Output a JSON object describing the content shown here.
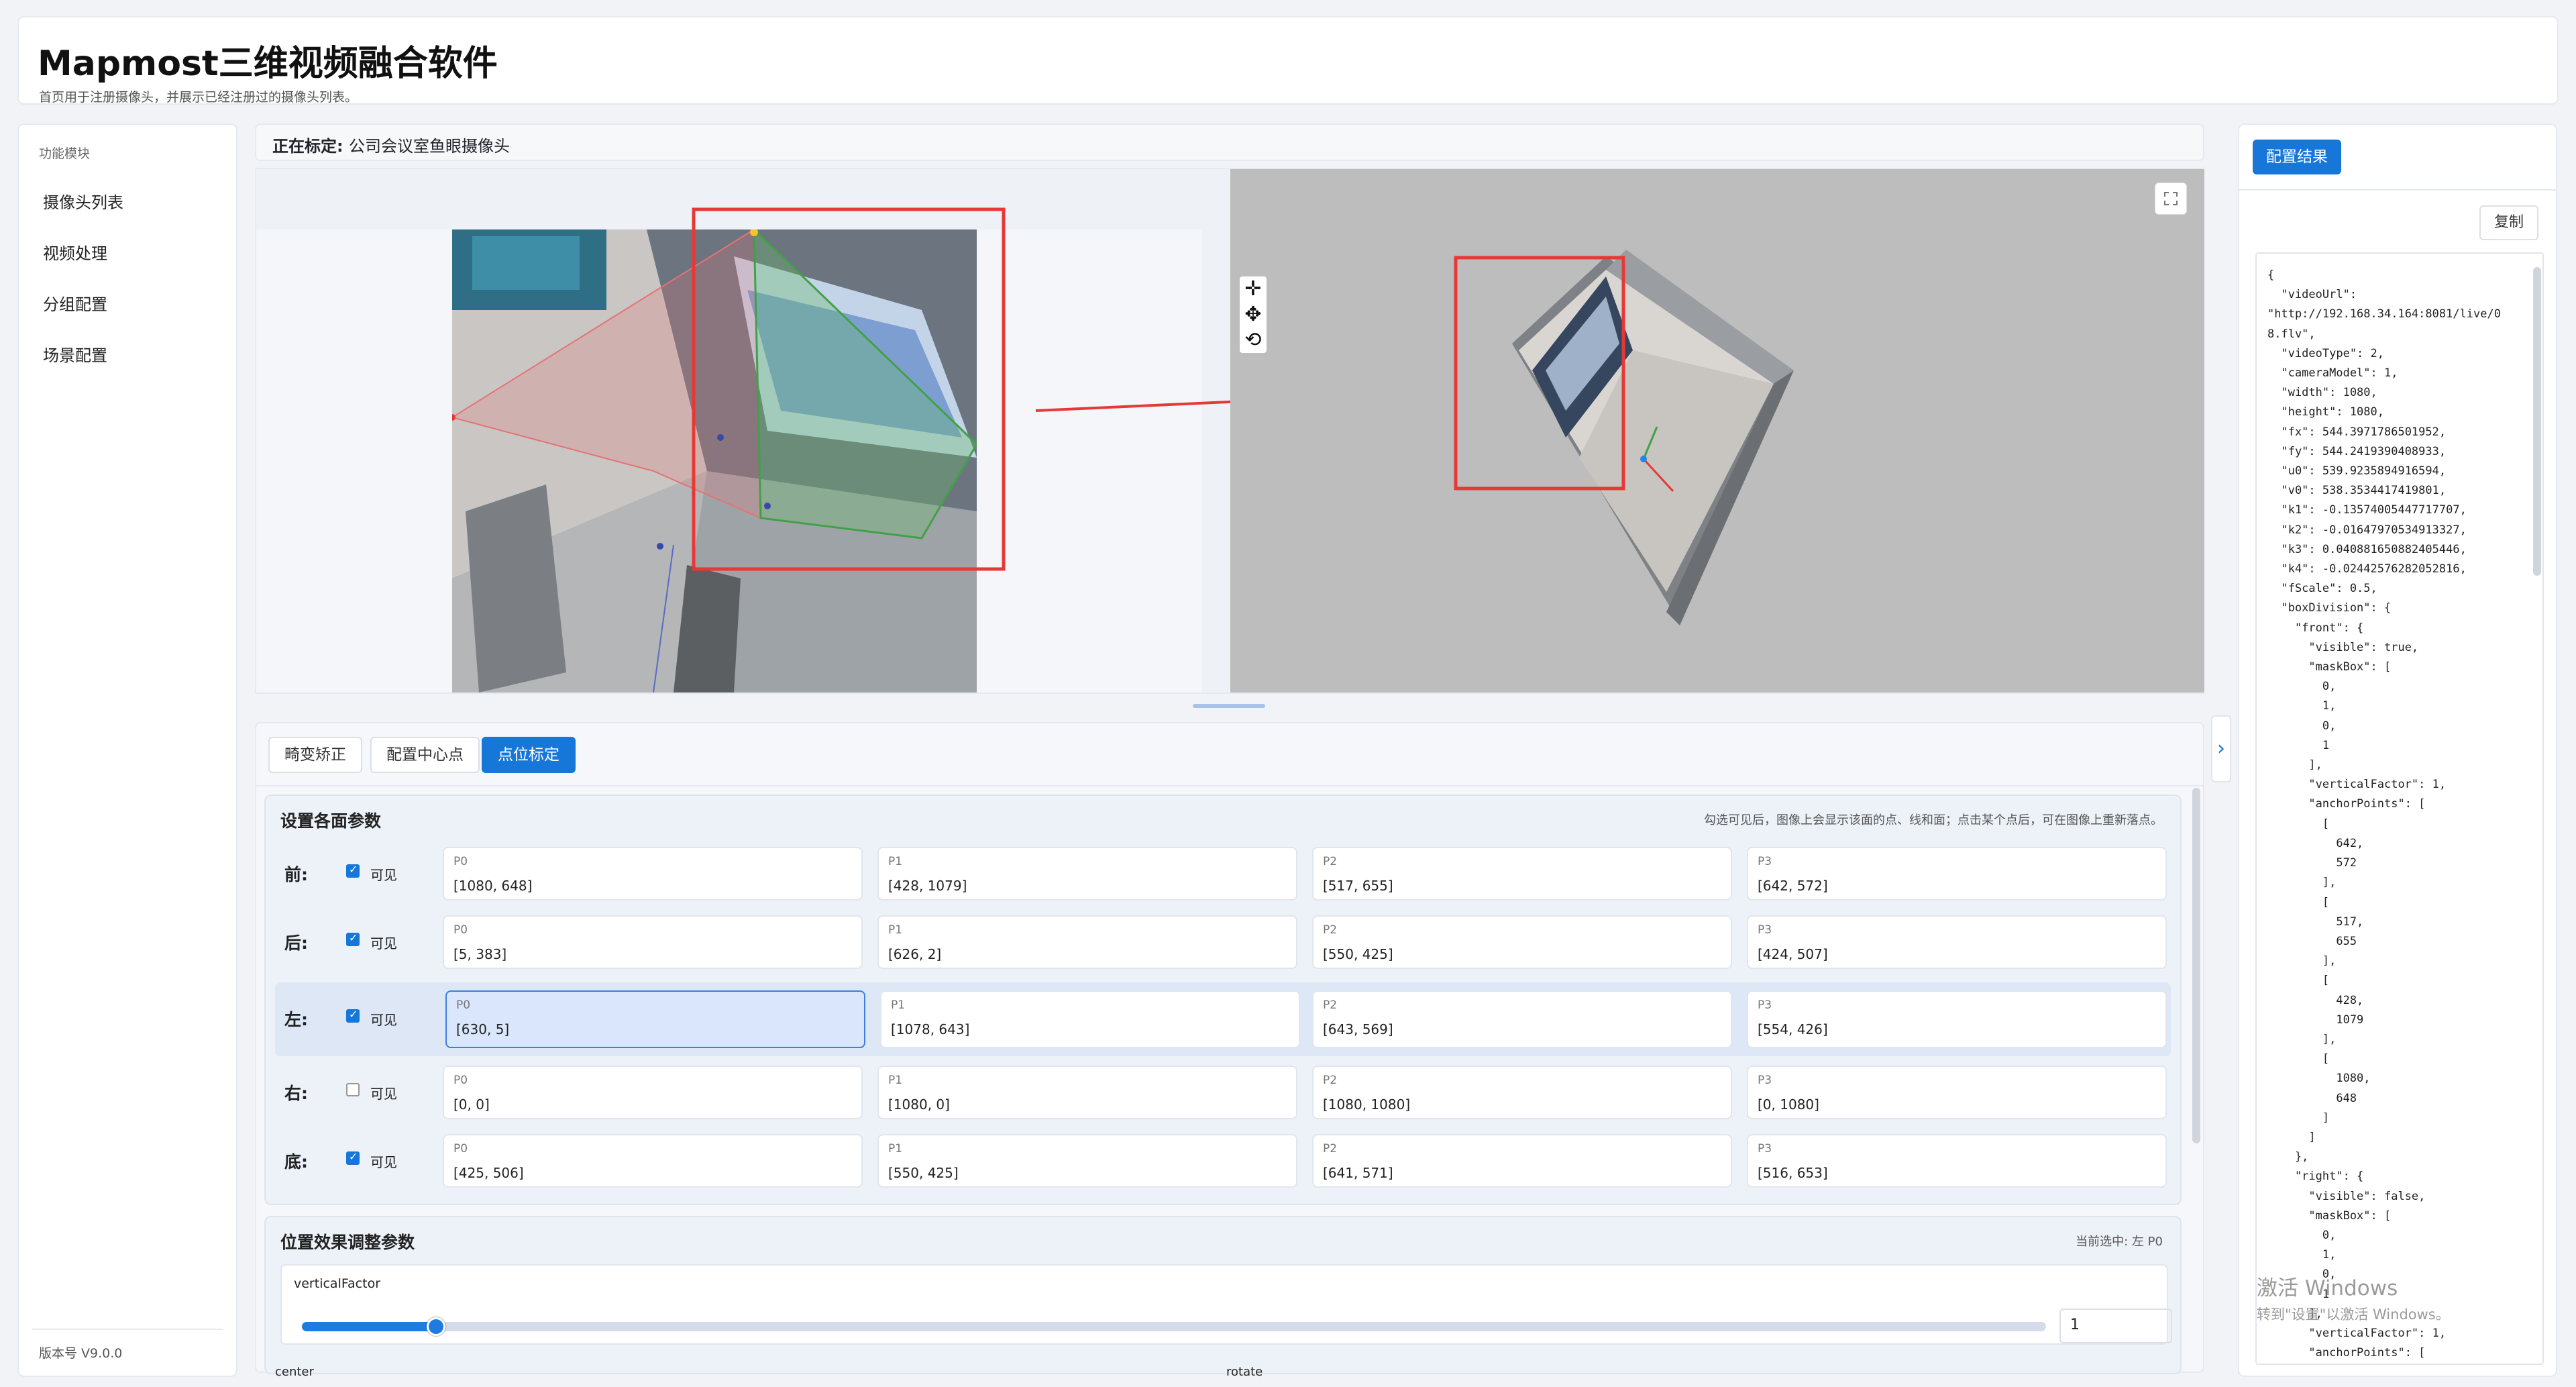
{
  "header": {
    "title": "Mapmost三维视频融合软件",
    "subtitle": "首页用于注册摄像头，并展示已经注册过的摄像头列表。"
  },
  "sidebar": {
    "group_label": "功能模块",
    "items": [
      {
        "label": "摄像头列表"
      },
      {
        "label": "视频处理"
      },
      {
        "label": "分组配置"
      },
      {
        "label": "场景配置"
      }
    ],
    "version": "版本号 V9.0.0"
  },
  "calibrating": {
    "label": "正在标定:",
    "camera": "公司会议室鱼眼摄像头"
  },
  "tabs": [
    {
      "label": "畸变矫正",
      "active": false
    },
    {
      "label": "配置中心点",
      "active": false
    },
    {
      "label": "点位标定",
      "active": true
    }
  ],
  "faces_panel": {
    "title": "设置各面参数",
    "hint": "勾选可见后，图像上会显示该面的点、线和面；点击某个点后，可在图像上重新落点。",
    "visible_label": "可见",
    "rows": [
      {
        "label": "前:",
        "visible": true,
        "selected": false,
        "points": [
          {
            "name": "P0",
            "value": "[1080, 648]"
          },
          {
            "name": "P1",
            "value": "[428, 1079]"
          },
          {
            "name": "P2",
            "value": "[517, 655]"
          },
          {
            "name": "P3",
            "value": "[642, 572]"
          }
        ]
      },
      {
        "label": "后:",
        "visible": true,
        "selected": false,
        "points": [
          {
            "name": "P0",
            "value": "[5, 383]"
          },
          {
            "name": "P1",
            "value": "[626, 2]"
          },
          {
            "name": "P2",
            "value": "[550, 425]"
          },
          {
            "name": "P3",
            "value": "[424, 507]"
          }
        ]
      },
      {
        "label": "左:",
        "visible": true,
        "selected": true,
        "points": [
          {
            "name": "P0",
            "value": "[630, 5]"
          },
          {
            "name": "P1",
            "value": "[1078, 643]"
          },
          {
            "name": "P2",
            "value": "[643, 569]"
          },
          {
            "name": "P3",
            "value": "[554, 426]"
          }
        ]
      },
      {
        "label": "右:",
        "visible": false,
        "selected": false,
        "points": [
          {
            "name": "P0",
            "value": "[0, 0]"
          },
          {
            "name": "P1",
            "value": "[1080, 0]"
          },
          {
            "name": "P2",
            "value": "[1080, 1080]"
          },
          {
            "name": "P3",
            "value": "[0, 1080]"
          }
        ]
      },
      {
        "label": "底:",
        "visible": true,
        "selected": false,
        "points": [
          {
            "name": "P0",
            "value": "[425, 506]"
          },
          {
            "name": "P1",
            "value": "[550, 425]"
          },
          {
            "name": "P2",
            "value": "[641, 571]"
          },
          {
            "name": "P3",
            "value": "[516, 653]"
          }
        ]
      }
    ]
  },
  "position_panel": {
    "title": "位置效果调整参数",
    "current": "当前选中: 左 P0",
    "slider_label": "verticalFactor",
    "slider_value": "1",
    "slider_fraction": 0.077,
    "center_label": "center",
    "rotate_label": "rotate"
  },
  "result": {
    "tab_label": "配置结果",
    "copy_label": "复制",
    "json_lines": [
      "{",
      "  \"videoUrl\":",
      "\"http://192.168.34.164:8081/live/0",
      "8.flv\",",
      "  \"videoType\": 2,",
      "  \"cameraModel\": 1,",
      "  \"width\": 1080,",
      "  \"height\": 1080,",
      "  \"fx\": 544.3971786501952,",
      "  \"fy\": 544.2419390408933,",
      "  \"u0\": 539.9235894916594,",
      "  \"v0\": 538.3534417419801,",
      "  \"k1\": -0.13574005447717707,",
      "  \"k2\": -0.01647970534913327,",
      "  \"k3\": 0.040881650882405446,",
      "  \"k4\": -0.02442576282052816,",
      "  \"fScale\": 0.5,",
      "  \"boxDivision\": {",
      "    \"front\": {",
      "      \"visible\": true,",
      "      \"maskBox\": [",
      "        0,",
      "        1,",
      "        0,",
      "        1",
      "      ],",
      "      \"verticalFactor\": 1,",
      "      \"anchorPoints\": [",
      "        [",
      "          642,",
      "          572",
      "        ],",
      "        [",
      "          517,",
      "          655",
      "        ],",
      "        [",
      "          428,",
      "          1079",
      "        ],",
      "        [",
      "          1080,",
      "          648",
      "        ]",
      "      ]",
      "    },",
      "    \"right\": {",
      "      \"visible\": false,",
      "      \"maskBox\": [",
      "        0,",
      "        1,",
      "        0,",
      "        1",
      "      ],",
      "      \"verticalFactor\": 1,",
      "      \"anchorPoints\": ["
    ]
  },
  "watermark": {
    "line1": "激活 Windows",
    "line2": "转到\"设置\"以激活 Windows。"
  },
  "icons": {
    "fullscreen": "fullscreen-icon",
    "pan": "move-icon",
    "rotate": "rotate-icon",
    "reset": "reset-view-icon",
    "collapse": "chevron-right-icon"
  },
  "colors": {
    "accent": "#1677d9",
    "annotation_red": "#e53935"
  }
}
